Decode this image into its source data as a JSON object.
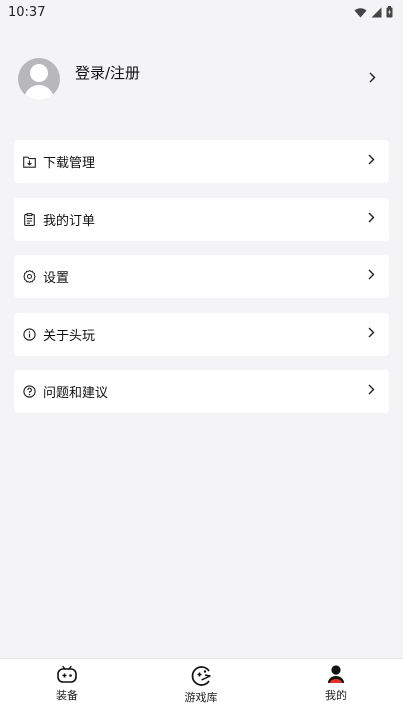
{
  "status_bar": {
    "time": "10:37",
    "icons": [
      "wifi-icon",
      "signal-icon",
      "battery-icon"
    ]
  },
  "profile": {
    "login_text": "登录/注册",
    "avatar_icon": "avatar-placeholder-icon"
  },
  "menu": {
    "items": [
      {
        "label": "下载管理",
        "icon": "download-folder-icon"
      },
      {
        "label": "我的订单",
        "icon": "clipboard-icon"
      },
      {
        "label": "设置",
        "icon": "gear-icon"
      },
      {
        "label": "关于头玩",
        "icon": "info-icon"
      },
      {
        "label": "问题和建议",
        "icon": "question-icon"
      }
    ]
  },
  "tab_bar": {
    "tabs": [
      {
        "label": "装备",
        "icon": "gamepad-icon",
        "active": false
      },
      {
        "label": "游戏库",
        "icon": "game-library-icon",
        "active": false
      },
      {
        "label": "我的",
        "icon": "user-icon",
        "active": true
      }
    ]
  },
  "colors": {
    "background": "#f4f4f6",
    "card": "#ffffff",
    "accent": "#e5332a"
  }
}
